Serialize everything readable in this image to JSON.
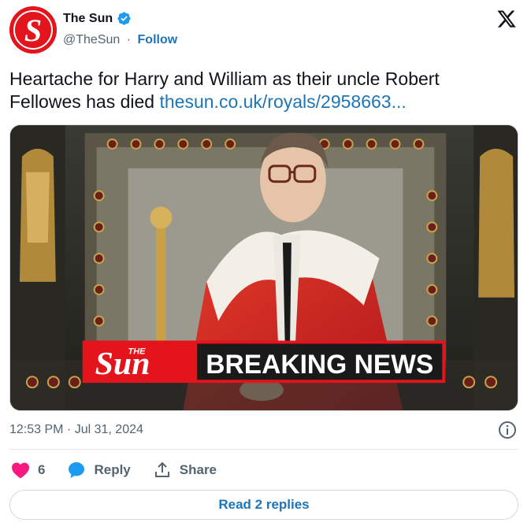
{
  "author": {
    "name": "The Sun",
    "handle": "@TheSun",
    "separator": "·",
    "follow_label": "Follow",
    "avatar_icon": "the-sun-s-logo",
    "verified_icon": "verified-badge-icon"
  },
  "platform_icon": "x-logo-icon",
  "tweet": {
    "text": "Heartache for Harry and William as their uncle Robert Fellowes has died ",
    "link": "thesun.co.uk/royals/2958663..."
  },
  "media": {
    "banner_brand": "Sun",
    "banner_brand_small": "THE",
    "banner_text": "BREAKING NEWS"
  },
  "timestamp": "12:53 PM · Jul 31, 2024",
  "actions": {
    "like_count": "6",
    "reply_label": "Reply",
    "share_label": "Share"
  },
  "read_replies_label": "Read 2 replies",
  "colors": {
    "accent": "#1d75b9",
    "like": "#f91880",
    "sun_red": "#e3141b",
    "verified": "#1d9bf0"
  }
}
